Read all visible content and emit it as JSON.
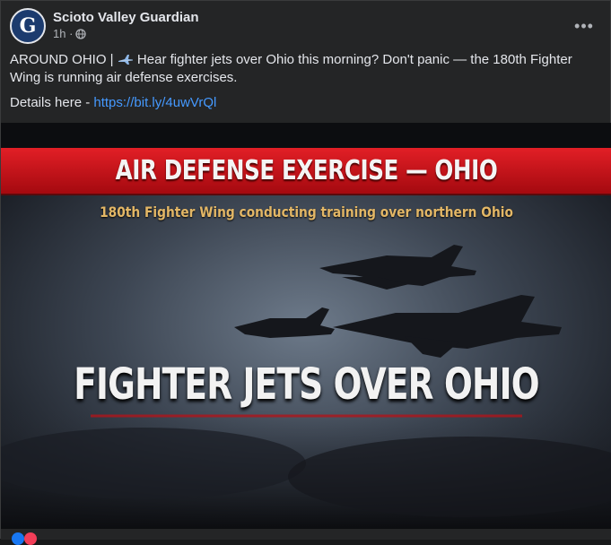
{
  "post": {
    "page_name": "Scioto Valley Guardian",
    "avatar_letter": "G",
    "time": "1h ·",
    "body_prefix": "AROUND OHIO |",
    "body_main": "Hear fighter jets over Ohio this morning? Don't panic — the 180th Fighter Wing is running air defense exercises.",
    "details_prefix": "Details here -",
    "link": "https://bit.ly/4uwVrQl",
    "more_label": "•••"
  },
  "image": {
    "banner_title": "AIR DEFENSE EXERCISE — OHIO",
    "banner_subtitle": "180th Fighter Wing conducting training over northern Ohio",
    "headline": "FIGHTER JETS OVER OHIO",
    "colors": {
      "banner_red": "#c5161d",
      "subtitle_gold": "#e3b766",
      "headline": "#f2f2f2"
    }
  }
}
